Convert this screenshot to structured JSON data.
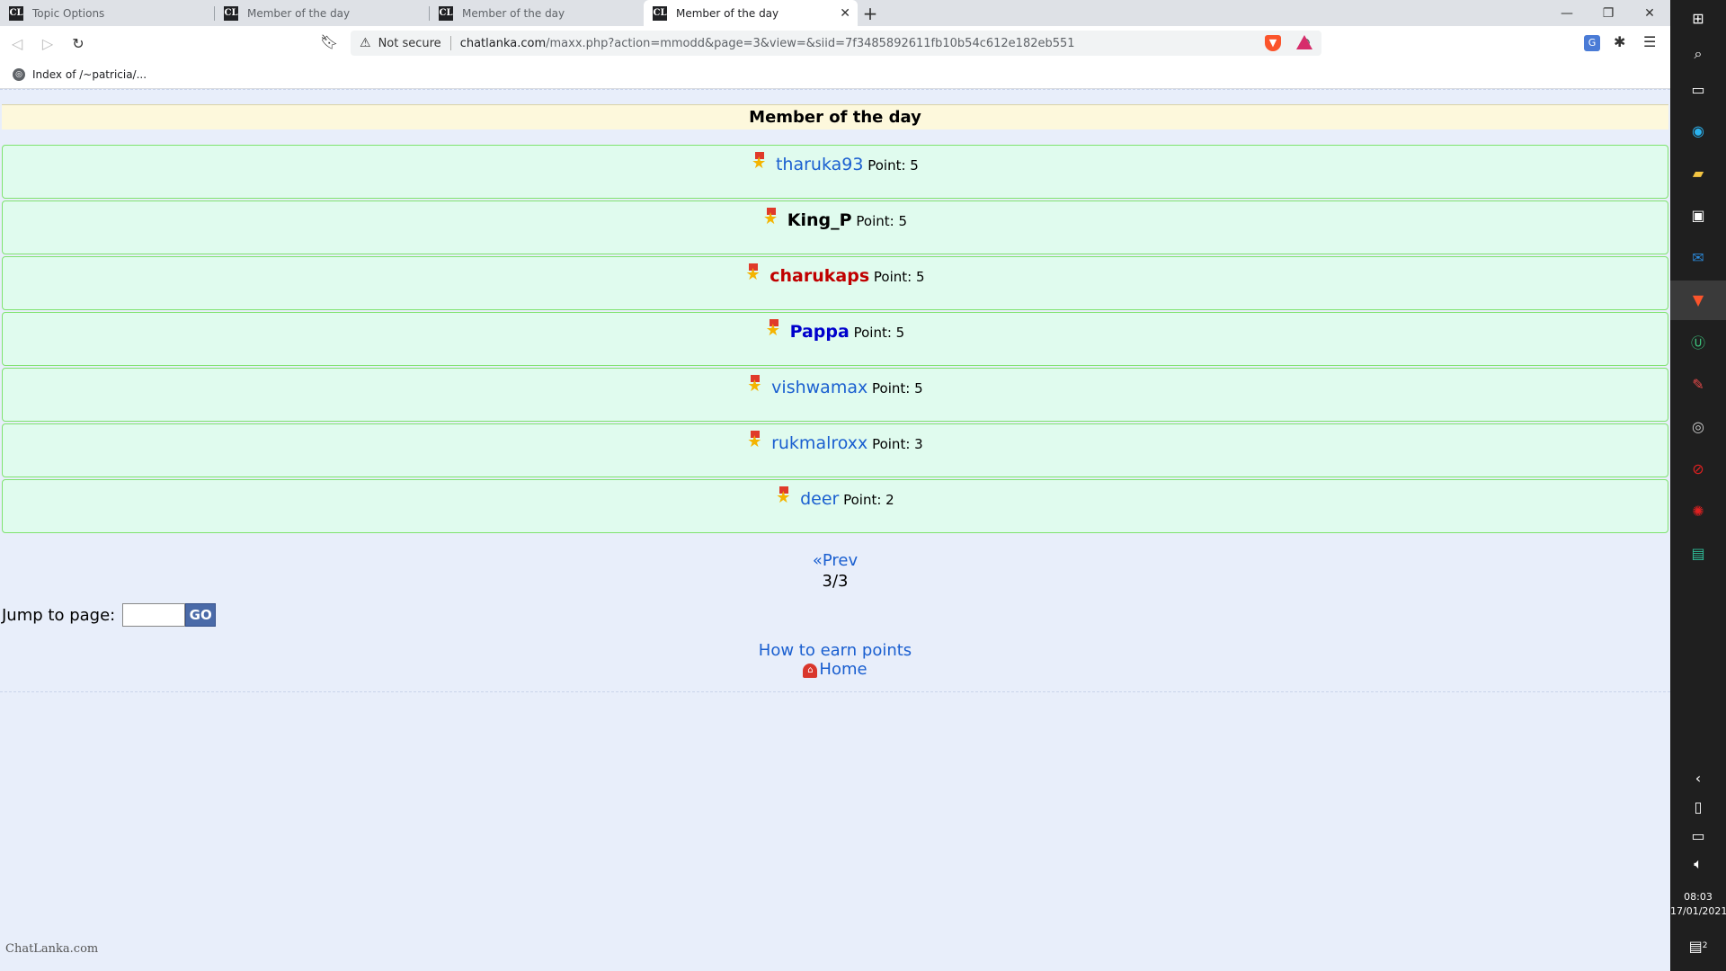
{
  "tabs": [
    {
      "title": "Topic Options",
      "active": false
    },
    {
      "title": "Member of the day",
      "active": false
    },
    {
      "title": "Member of the day",
      "active": false
    },
    {
      "title": "Member of the day",
      "active": true
    }
  ],
  "toolbar": {
    "security_label": "Not secure",
    "url_host": "chatlanka.com",
    "url_path": "/maxx.php?action=mmodd&page=3&view=&siid=7f3485892611fb10b54c612e182eb551"
  },
  "bookmarks": [
    {
      "label": "Index of /~patricia/..."
    }
  ],
  "page": {
    "title": "Member of the day",
    "members": [
      {
        "name": "tharuka93",
        "points": "Point: 5"
      },
      {
        "name": "King_P",
        "points": "Point: 5"
      },
      {
        "name": "charukaps",
        "points": "Point: 5"
      },
      {
        "name": "Pappa",
        "points": "Point: 5"
      },
      {
        "name": "vishwamax",
        "points": "Point: 5"
      },
      {
        "name": "rukmalroxx",
        "points": "Point: 3"
      },
      {
        "name": "deer",
        "points": "Point: 2"
      }
    ],
    "prev_label": "«Prev",
    "page_indicator": "3/3",
    "jump_label": "Jump to page:",
    "go_label": "GO",
    "earn_points_label": "How to earn points",
    "home_label": "Home",
    "footer_logo": "ChatLanka.com"
  },
  "taskbar": {
    "time": "08:03",
    "date": "17/01/2021",
    "notification_count": "2"
  }
}
